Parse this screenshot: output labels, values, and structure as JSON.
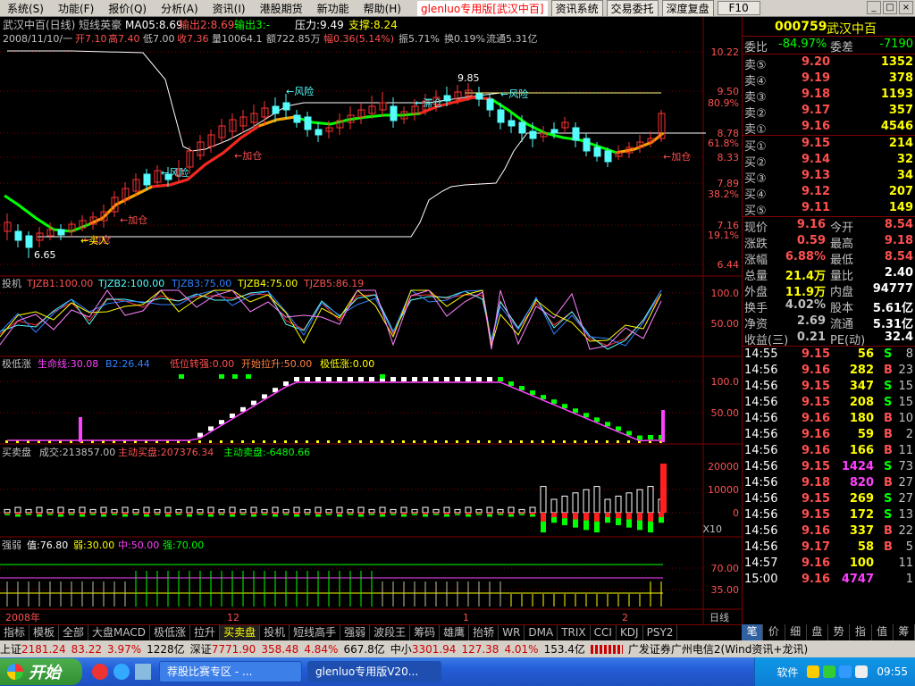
{
  "menu": {
    "items": [
      "系统(S)",
      "功能(F)",
      "报价(Q)",
      "分析(A)",
      "资讯(I)",
      "港股期货",
      "新功能",
      "帮助(H)"
    ],
    "brand": "glenluo专用版[武汉中百]",
    "buttons": [
      "资讯系统",
      "交易委托",
      "深度复盘",
      "F10"
    ]
  },
  "header": {
    "title": "武汉中百(日线) 短线英豪",
    "ma": "MA05:8.69",
    "out2": "输出2:8.69",
    "out3": "输出3:-",
    "pressure": "压力:9.49",
    "support": "支撑:8.24"
  },
  "info": {
    "date": "2008/11/10/一",
    "open": "开7.10",
    "high": "高7.40",
    "low": "低7.00",
    "close": "收7.36",
    "vol": "量10064.1",
    "amount": "额722.85万",
    "range": "幅0.36(5.14%)",
    "amp": "振5.71%",
    "turnover": "换0.19%",
    "float": "流通5.31亿"
  },
  "axis_prices": [
    "10.22",
    "9.50",
    "8.78",
    "8.33",
    "7.89",
    "7.16",
    "6.44"
  ],
  "axis_pcts": [
    "80.9%",
    "61.8%",
    "38.2%",
    "19.1%"
  ],
  "annotations": [
    "9.85",
    "6.65",
    "←风险",
    "←风险",
    "←风险",
    "←滞仓",
    "←加仓",
    "←加仓",
    "←加仓",
    "←加仓",
    "←买入"
  ],
  "panels": {
    "p1": {
      "name": "投机",
      "l1": "TJZB1:100.00",
      "l2": "TJZB2:100.00",
      "l3": "TJZB3:75.00",
      "l4": "TJZB4:75.00",
      "l5": "TJZB5:86.19",
      "ticks": [
        "100.0",
        "50.00"
      ]
    },
    "p2": {
      "name": "极低涨",
      "l1": "生命线:30.08",
      "l2": "B2:26.44",
      "l3": "低位转强:0.00",
      "l4": "开始拉升:50.00",
      "l5": "极低涨:0.00",
      "ticks": [
        "100.0",
        "50.00"
      ]
    },
    "p3": {
      "name": "买卖盘",
      "l1": "成交:213857.00",
      "l2": "主动买盘:207376.34",
      "l3": "主动卖盘:-6480.66",
      "ticks": [
        "20000",
        "10000",
        "0"
      ],
      "mult": "X10"
    },
    "p4": {
      "name": "强弱",
      "l1": "值:76.80",
      "l2": "弱:30.00",
      "l3": "中:50.00",
      "l4": "强:70.00",
      "ticks": [
        "70.00",
        "35.00"
      ]
    }
  },
  "timeline": [
    "2008年",
    "12",
    "1",
    "2"
  ],
  "period": "日线",
  "stock": {
    "code": "000759",
    "name": "武汉中百"
  },
  "quote": {
    "wb_label": "委比",
    "wb": "-84.97%",
    "wc_label": "委差",
    "wc": "-7190"
  },
  "asks": [
    {
      "l": "卖⑤",
      "p": "9.20",
      "v": "1352"
    },
    {
      "l": "卖④",
      "p": "9.19",
      "v": "378"
    },
    {
      "l": "卖③",
      "p": "9.18",
      "v": "1193"
    },
    {
      "l": "卖②",
      "p": "9.17",
      "v": "357"
    },
    {
      "l": "卖①",
      "p": "9.16",
      "v": "4546"
    }
  ],
  "bids": [
    {
      "l": "买①",
      "p": "9.15",
      "v": "214"
    },
    {
      "l": "买②",
      "p": "9.14",
      "v": "32"
    },
    {
      "l": "买③",
      "p": "9.13",
      "v": "34"
    },
    {
      "l": "买④",
      "p": "9.12",
      "v": "207"
    },
    {
      "l": "买⑤",
      "p": "9.11",
      "v": "149"
    }
  ],
  "stats": [
    {
      "a": "现价",
      "av": "9.16",
      "b": "今开",
      "bv": "8.54"
    },
    {
      "a": "涨跌",
      "av": "0.59",
      "b": "最高",
      "bv": "9.18"
    },
    {
      "a": "涨幅",
      "av": "6.88%",
      "b": "最低",
      "bv": "8.54"
    },
    {
      "a": "总量",
      "av": "21.4万",
      "b": "量比",
      "bv": "2.40"
    },
    {
      "a": "外盘",
      "av": "11.9万",
      "b": "内盘",
      "bv": "94777"
    },
    {
      "a": "换手",
      "av": "4.02%",
      "b": "股本",
      "bv": "5.61亿"
    },
    {
      "a": "净资",
      "av": "2.69",
      "b": "流通",
      "bv": "5.31亿"
    },
    {
      "a": "收益(三)",
      "av": "0.21",
      "b": "PE(动)",
      "bv": "32.4"
    }
  ],
  "ticks": [
    {
      "t": "14:55",
      "p": "9.15",
      "v": "56",
      "d": "S",
      "n": "8"
    },
    {
      "t": "14:56",
      "p": "9.16",
      "v": "282",
      "d": "B",
      "n": "23"
    },
    {
      "t": "14:56",
      "p": "9.15",
      "v": "347",
      "d": "S",
      "n": "15"
    },
    {
      "t": "14:56",
      "p": "9.15",
      "v": "208",
      "d": "S",
      "n": "15"
    },
    {
      "t": "14:56",
      "p": "9.16",
      "v": "180",
      "d": "B",
      "n": "10"
    },
    {
      "t": "14:56",
      "p": "9.16",
      "v": "59",
      "d": "B",
      "n": "2"
    },
    {
      "t": "14:56",
      "p": "9.16",
      "v": "166",
      "d": "B",
      "n": "11"
    },
    {
      "t": "14:56",
      "p": "9.15",
      "v": "1424",
      "d": "S",
      "n": "73"
    },
    {
      "t": "14:56",
      "p": "9.18",
      "v": "820",
      "d": "B",
      "n": "27"
    },
    {
      "t": "14:56",
      "p": "9.15",
      "v": "269",
      "d": "S",
      "n": "27"
    },
    {
      "t": "14:56",
      "p": "9.15",
      "v": "172",
      "d": "S",
      "n": "13"
    },
    {
      "t": "14:56",
      "p": "9.16",
      "v": "337",
      "d": "B",
      "n": "22"
    },
    {
      "t": "14:56",
      "p": "9.17",
      "v": "58",
      "d": "B",
      "n": "5"
    },
    {
      "t": "14:57",
      "p": "9.16",
      "v": "100",
      "d": "",
      "n": "11"
    },
    {
      "t": "15:00",
      "p": "9.16",
      "v": "4747",
      "d": "",
      "n": "1"
    }
  ],
  "tabs": [
    "指标",
    "模板",
    "全部",
    "大盘MACD",
    "极低涨",
    "拉升",
    "买卖盘",
    "投机",
    "短线高手",
    "强弱",
    "波段王",
    "筹码",
    "雄鹰",
    "抬轿",
    "WR",
    "DMA",
    "TRIX",
    "CCI",
    "KDJ",
    "PSY2"
  ],
  "rtabs": [
    "笔",
    "价",
    "细",
    "盘",
    "势",
    "指",
    "值",
    "筹"
  ],
  "statusbar": {
    "sh": "上证",
    "shv": "2181.24",
    "shc": "83.22",
    "shp": "3.97%",
    "sha": "1228亿",
    "sz": "深证",
    "szv": "7771.90",
    "szc": "358.48",
    "szp": "4.84%",
    "sza": "667.8亿",
    "zx": "中小",
    "zxv": "3301.94",
    "zxc": "127.38",
    "zxp": "4.01%",
    "zxa": "153.4亿",
    "broker": "广发证券广州电信2(Wind资讯+龙讯)"
  },
  "taskbar": {
    "start": "开始",
    "tasks": [
      "荐股比赛专区 - ...",
      "glenluo专用版V20..."
    ],
    "tray": "软件",
    "clock": "09:55"
  },
  "colors": {
    "up": "#ff3232",
    "down": "#54fcfc",
    "bg": "#000000",
    "grid": "#800000",
    "ma": "#ffff00"
  }
}
